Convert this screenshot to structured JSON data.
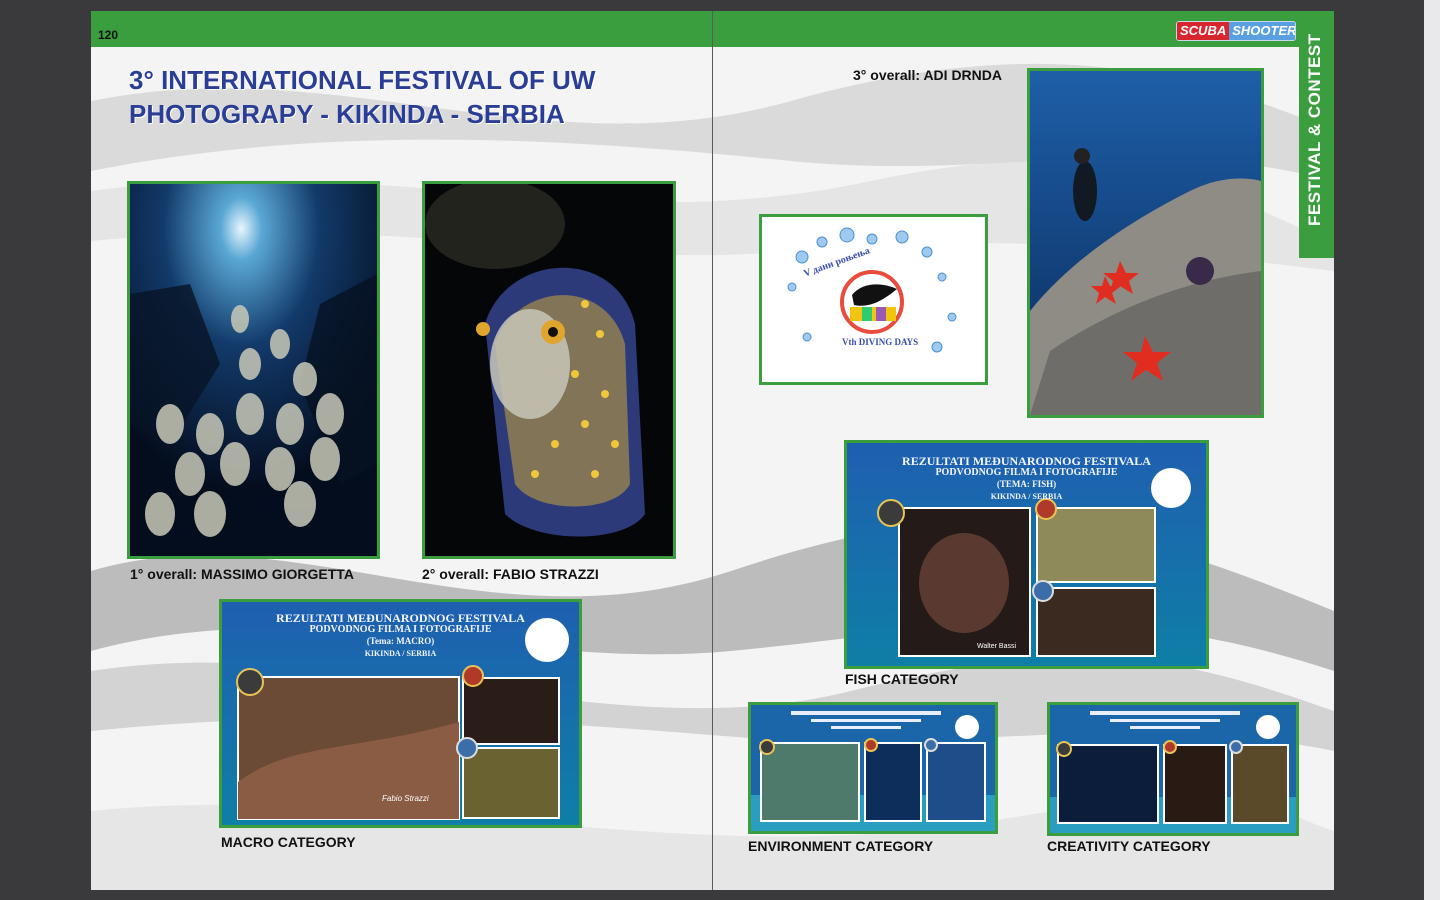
{
  "page": {
    "number": "120"
  },
  "brand": {
    "part_a": "SCUBA",
    "part_b": "SHOOTERS"
  },
  "section_tab": "FESTIVAL & CONTEST",
  "article": {
    "title_line1": "3° INTERNATIONAL FESTIVAL OF UW",
    "title_line2": "PHOTOGRAPY - KIKINDA - SERBIA"
  },
  "captions": {
    "first": "1° overall: MASSIMO GIORGETTA",
    "second": "2° overall: FABIO STRAZZI",
    "third": "3° overall: ADI DRNDA",
    "macro": "MACRO CATEGORY",
    "fish": "FISH CATEGORY",
    "environment": "ENVIRONMENT CATEGORY",
    "creativity": "CREATIVITY CATEGORY"
  },
  "posters": {
    "line1": "REZULTATI MEĐUNARODNOG FESTIVALA",
    "line2": "PODVODNOG FILMA I FOTOGRAFIJE",
    "macro_theme": "(Tema: MACRO)",
    "fish_theme": "(TEMA: FISH)",
    "location": "KIKINDA / SERBIA",
    "macro_author": "Fabio Strazzi",
    "fish_author": "Walter Bassi"
  },
  "logo_text": {
    "top": "V дани роњења",
    "bottom": "Vth DIVING DAYS"
  },
  "colors": {
    "accent_green": "#3a9e3e",
    "title_blue": "#2a3e96",
    "brand_red": "#d8262f",
    "brand_blue": "#5aa0e0"
  }
}
